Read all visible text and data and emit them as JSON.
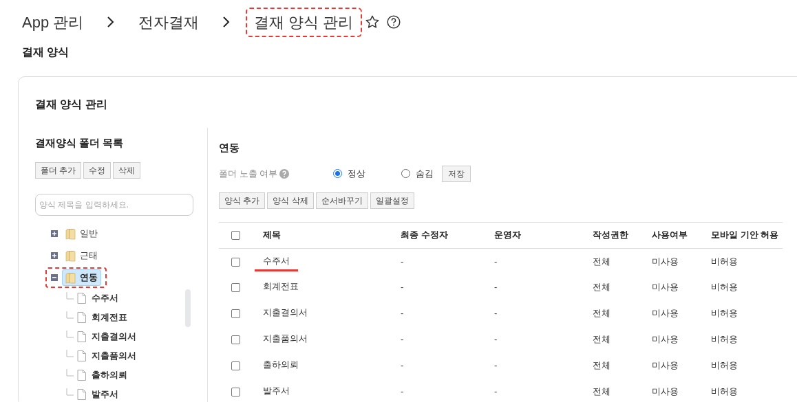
{
  "breadcrumb": [
    {
      "label": "App 관리",
      "highlighted": false
    },
    {
      "label": "전자결재",
      "highlighted": false
    },
    {
      "label": "결재 양식 관리",
      "highlighted": true
    }
  ],
  "favorite": false,
  "section_title": "결재 양식",
  "card_title": "결재 양식 관리",
  "folder_panel": {
    "title": "결재양식 폴더 목록",
    "buttons": [
      "폴더 추가",
      "수정",
      "삭제"
    ],
    "search": {
      "placeholder": "양식 제목을 입력하세요."
    },
    "tree": [
      {
        "label": "일반",
        "expanded": false,
        "selected": false,
        "highlighted": false
      },
      {
        "label": "근태",
        "expanded": false,
        "selected": false,
        "highlighted": false
      },
      {
        "label": "연동",
        "expanded": true,
        "selected": true,
        "highlighted": true,
        "children": [
          {
            "label": "수주서"
          },
          {
            "label": "회계전표"
          },
          {
            "label": "지출결의서"
          },
          {
            "label": "지출품의서"
          },
          {
            "label": "출하의뢰"
          },
          {
            "label": "발주서"
          }
        ]
      }
    ]
  },
  "detail": {
    "title": "연동",
    "visibility": {
      "label": "폴더 노출 여부",
      "options": [
        {
          "label": "정상",
          "selected": true
        },
        {
          "label": "숨김",
          "selected": false
        }
      ],
      "save": "저장"
    },
    "buttons": [
      "양식 추가",
      "양식 삭제",
      "순서바꾸기",
      "일괄설정"
    ],
    "table": {
      "select_all": false,
      "columns": [
        "제목",
        "최종 수정자",
        "운영자",
        "작성권한",
        "사용여부",
        "모바일 기안 허용"
      ],
      "rows": [
        {
          "checked": false,
          "underlined": true,
          "cells": [
            "수주서",
            "-",
            "-",
            "전체",
            "미사용",
            "비허용"
          ]
        },
        {
          "checked": false,
          "underlined": false,
          "cells": [
            "회계전표",
            "-",
            "-",
            "전체",
            "미사용",
            "비허용"
          ]
        },
        {
          "checked": false,
          "underlined": false,
          "cells": [
            "지출결의서",
            "-",
            "-",
            "전체",
            "미사용",
            "비허용"
          ]
        },
        {
          "checked": false,
          "underlined": false,
          "cells": [
            "지출품의서",
            "-",
            "-",
            "전체",
            "미사용",
            "비허용"
          ]
        },
        {
          "checked": false,
          "underlined": false,
          "cells": [
            "출하의뢰",
            "-",
            "-",
            "전체",
            "미사용",
            "비허용"
          ]
        },
        {
          "checked": false,
          "underlined": false,
          "cells": [
            "발주서",
            "-",
            "-",
            "전체",
            "미사용",
            "비허용"
          ]
        }
      ]
    }
  }
}
